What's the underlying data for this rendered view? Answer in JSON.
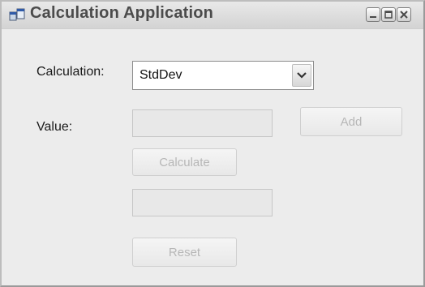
{
  "window": {
    "title": "Calculation Application"
  },
  "form": {
    "calculation_label": "Calculation:",
    "calculation_selected": "StdDev",
    "value_label": "Value:",
    "value_input": "",
    "result_input": "",
    "add_label": "Add",
    "calculate_label": "Calculate",
    "reset_label": "Reset"
  },
  "icons": {
    "app": "form-window-icon",
    "minimize": "minimize-icon",
    "maximize": "maximize-icon",
    "close": "close-icon",
    "dropdown": "chevron-down-icon"
  }
}
